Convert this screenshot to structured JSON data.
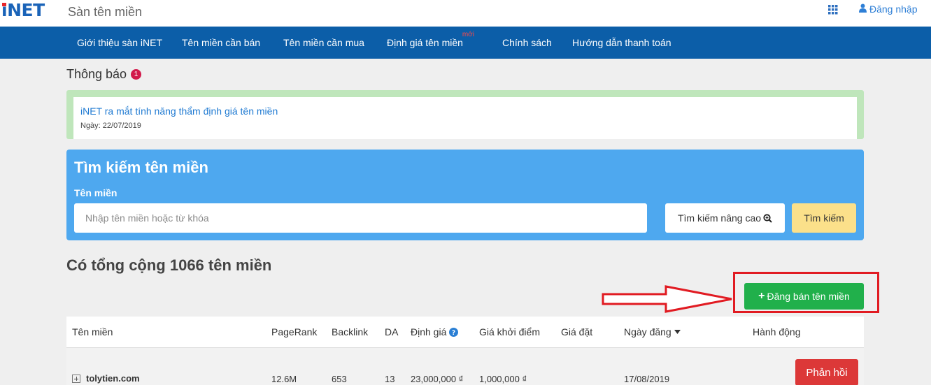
{
  "header": {
    "logo": "iNET",
    "site_name": "Sàn tên miền",
    "login_label": "Đăng nhập"
  },
  "nav": {
    "items": [
      {
        "label": "Giới thiệu sàn iNET"
      },
      {
        "label": "Tên miền cần bán"
      },
      {
        "label": "Tên miền cần mua"
      },
      {
        "label": "Định giá tên miền",
        "badge": "mới"
      },
      {
        "label": "Chính sách"
      },
      {
        "label": "Hướng dẫn thanh toán"
      }
    ]
  },
  "notice": {
    "title": "Thông báo",
    "count": "1",
    "link": "iNET ra mắt tính năng thẩm định giá tên miền",
    "date": "Ngày: 22/07/2019"
  },
  "search": {
    "title": "Tìm kiếm tên miền",
    "label": "Tên miền",
    "placeholder": "Nhập tên miền hoặc từ khóa",
    "value": "",
    "advanced_label": "Tìm kiếm nâng cao",
    "submit_label": "Tìm kiếm"
  },
  "summary": {
    "total_text": "Có tổng cộng 1066 tên miền"
  },
  "actions": {
    "sell_label": "Đăng bán tên miền"
  },
  "colors": {
    "nav_bg": "#0c5ea8",
    "search_bg": "#4ea8ef",
    "sell_green": "#21b04b",
    "reply_red": "#dc3838",
    "highlight_red": "#e11b22"
  },
  "table": {
    "columns": [
      "Tên miền",
      "PageRank",
      "Backlink",
      "DA",
      "Định giá",
      "Giá khởi điểm",
      "Giá đặt",
      "Ngày đăng",
      "Hành động"
    ],
    "rows": [
      {
        "domain": "tolytien.com",
        "pagerank": "12.6M",
        "backlink": "653",
        "da": "13",
        "valuation": "23,000,000 ₫",
        "start_price": "1,000,000 ₫",
        "bid": "",
        "date": "17/08/2019",
        "action": "Phản hồi"
      }
    ]
  }
}
